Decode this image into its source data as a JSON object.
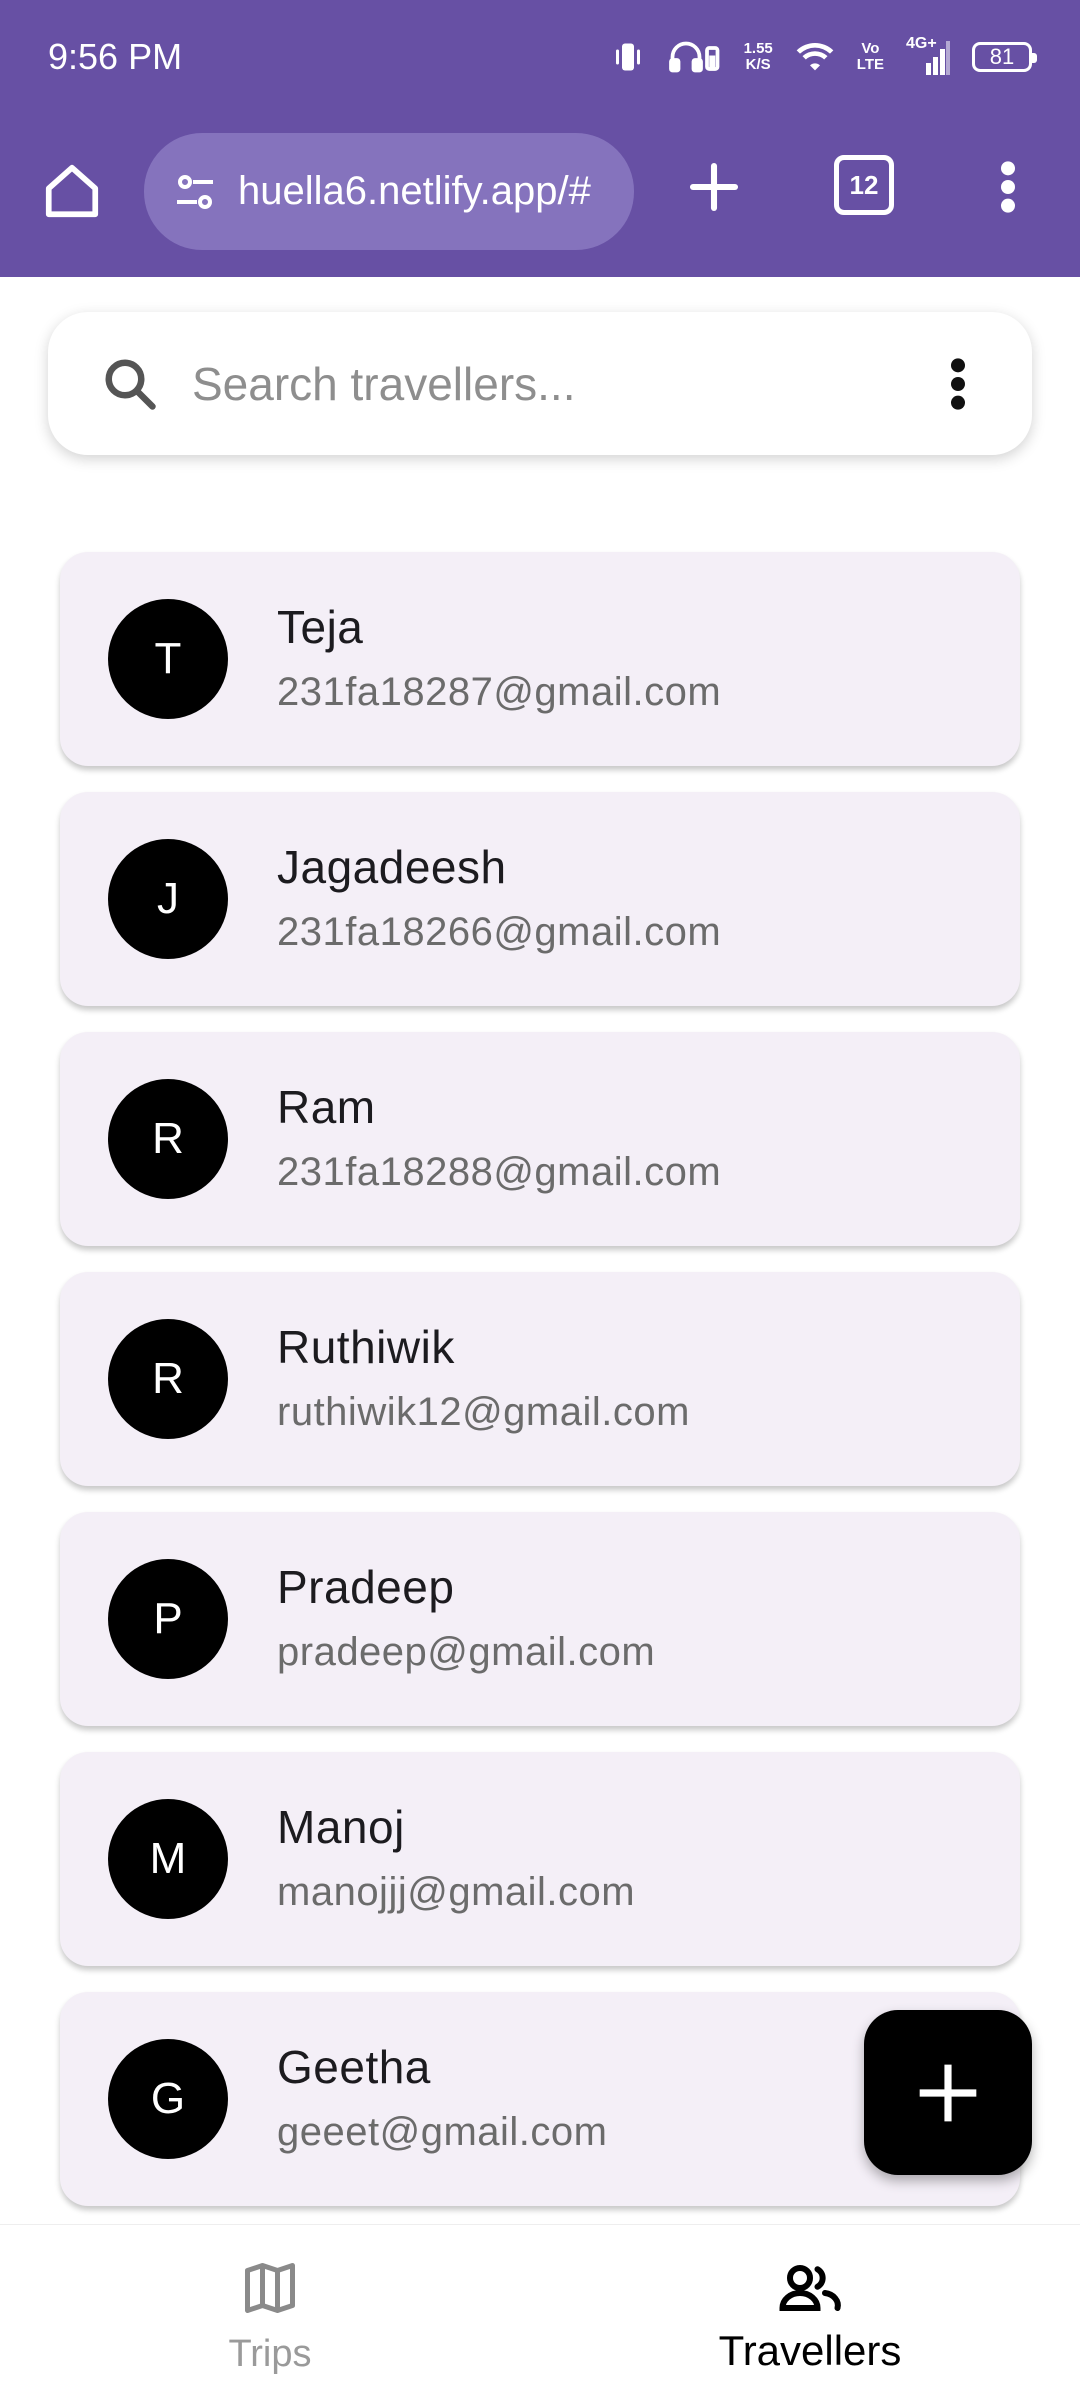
{
  "status_bar": {
    "time": "9:56 PM",
    "net_speed_value": "1.55",
    "net_speed_unit": "K/S",
    "vo": "Vo",
    "lte": "LTE",
    "network": "4G+",
    "battery": "81"
  },
  "browser": {
    "url": "huella6.netlify.app/#",
    "tab_count": "12"
  },
  "search": {
    "placeholder": "Search travellers..."
  },
  "travellers": [
    {
      "initial": "T",
      "name": "Teja",
      "email": "231fa18287@gmail.com"
    },
    {
      "initial": "J",
      "name": "Jagadeesh",
      "email": "231fa18266@gmail.com"
    },
    {
      "initial": "R",
      "name": "Ram",
      "email": "231fa18288@gmail.com"
    },
    {
      "initial": "R",
      "name": "Ruthiwik",
      "email": "ruthiwik12@gmail.com"
    },
    {
      "initial": "P",
      "name": "Pradeep",
      "email": "pradeep@gmail.com"
    },
    {
      "initial": "M",
      "name": "Manoj",
      "email": "manojjj@gmail.com"
    },
    {
      "initial": "G",
      "name": "Geetha",
      "email": "geeet@gmail.com"
    }
  ],
  "bottom_nav": {
    "trips_label": "Trips",
    "travellers_label": "Travellers",
    "active": "Travellers"
  },
  "colors": {
    "app_bar": "#6750A4",
    "url_pill": "#8573BD",
    "card_bg": "#F4EFF7",
    "avatar_bg": "#000000",
    "fab_bg": "#000000"
  },
  "icons": {
    "home": "home-icon",
    "site_settings": "tune-icon",
    "new_tab": "plus-icon",
    "menu": "more-vert-icon",
    "search": "search-icon",
    "fab": "add-icon",
    "trips": "map-icon",
    "travellers": "people-icon"
  }
}
